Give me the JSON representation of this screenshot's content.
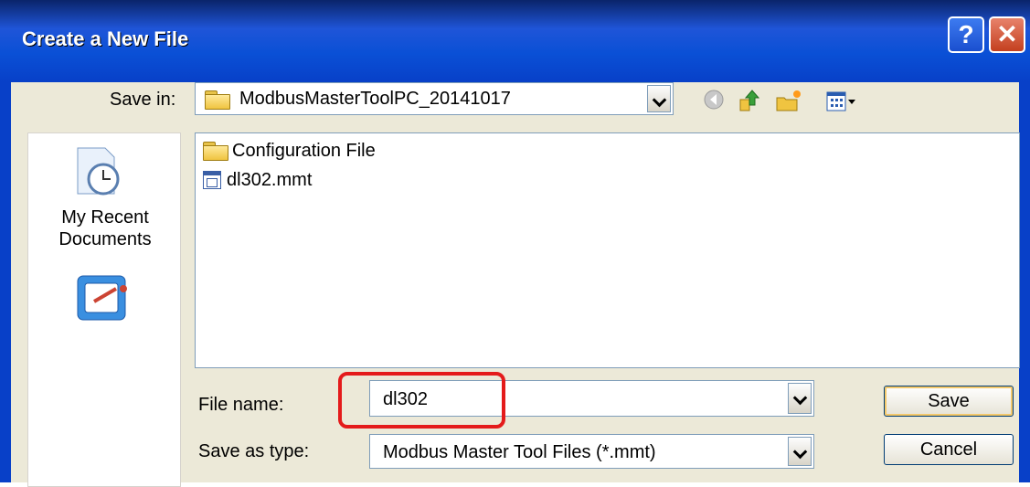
{
  "dialog": {
    "title": "Create a New File",
    "help_label": "?",
    "close_label": "✕"
  },
  "save_in": {
    "label": "Save in:",
    "value": "ModbusMasterToolPC_20141017"
  },
  "places": [
    {
      "label": "My Recent\nDocuments",
      "icon": "recent-documents-icon"
    },
    {
      "label": "",
      "icon": "desktop-icon"
    }
  ],
  "files": [
    {
      "name": "Configuration File",
      "icon": "folder-icon"
    },
    {
      "name": "dl302.mmt",
      "icon": "file-icon"
    }
  ],
  "file_name": {
    "label": "File name:",
    "value": "dl302"
  },
  "save_as_type": {
    "label": "Save as type:",
    "value": "Modbus Master Tool Files (*.mmt)"
  },
  "buttons": {
    "save": "Save",
    "cancel": "Cancel"
  },
  "colors": {
    "title_bar": "#0a50d6",
    "highlight": "#e41b1b"
  }
}
